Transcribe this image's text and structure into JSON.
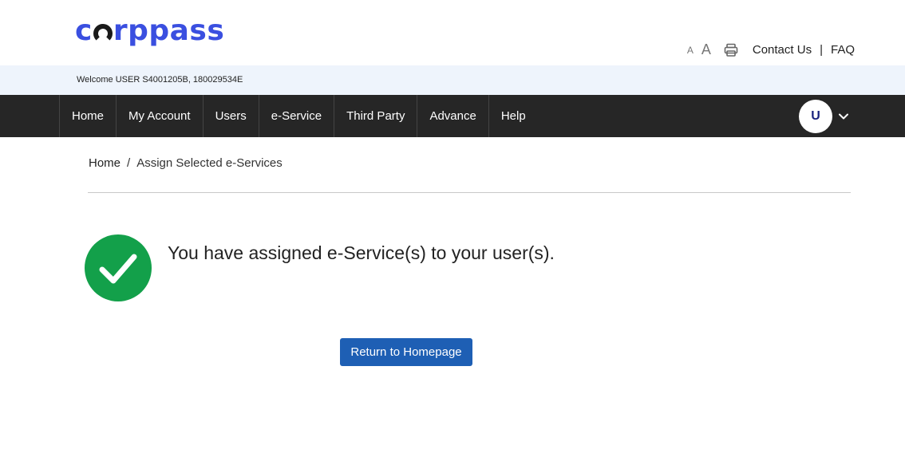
{
  "brand": {
    "logo_text_pre": "c",
    "logo_text_post": "rppass"
  },
  "utils": {
    "font_small": "A",
    "font_large": "A",
    "print_icon": "printer-icon",
    "contact": "Contact Us",
    "separator": "|",
    "faq": "FAQ"
  },
  "welcome": {
    "text": "Welcome USER S4001205B, 180029534E"
  },
  "nav": {
    "items": [
      {
        "label": "Home"
      },
      {
        "label": "My Account"
      },
      {
        "label": "Users"
      },
      {
        "label": "e-Service"
      },
      {
        "label": "Third Party"
      },
      {
        "label": "Advance"
      },
      {
        "label": "Help"
      }
    ],
    "avatar_initial": "U",
    "menu_icon": "chevron-down-icon"
  },
  "breadcrumb": {
    "home": "Home",
    "separator": "/",
    "current": "Assign Selected e-Services"
  },
  "main": {
    "success_icon": "check-circle-icon",
    "message": "You have assigned e-Service(s) to your user(s).",
    "button": "Return to Homepage"
  },
  "colors": {
    "brand": "#3a4fe0",
    "nav_bg": "#262626",
    "welcome_bg": "#eef4fc",
    "success": "#13a04a",
    "button": "#1e5fb4"
  }
}
